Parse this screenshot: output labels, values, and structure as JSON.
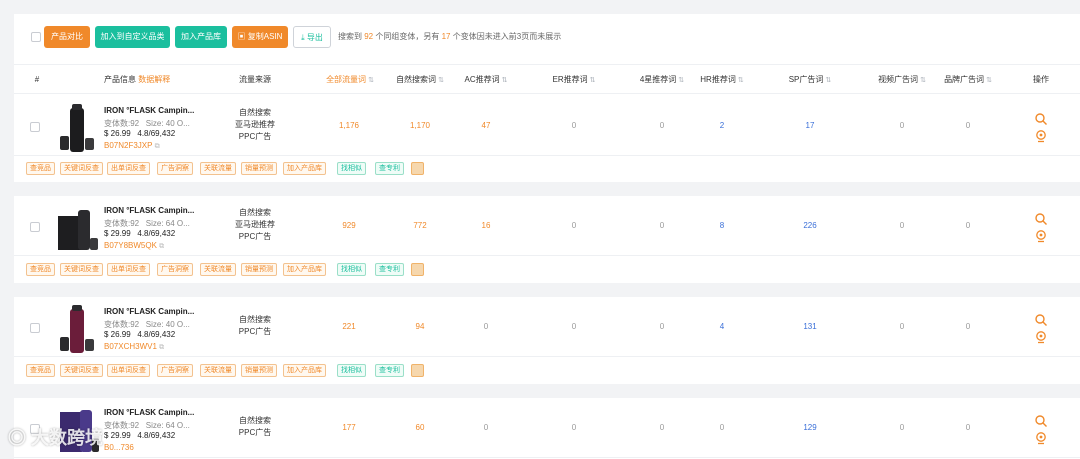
{
  "toolbar": {
    "compare_label": "产品对比",
    "add_custom_label": "加入到自定义品类",
    "add_library_label": "加入产品库",
    "copy_asin_label": "复制ASIN",
    "export_label": "导出",
    "info_prefix": "搜索到",
    "info_count": "92",
    "info_mid": "个同组变体，另有",
    "info_other": "17",
    "info_suffix": "个变体因未进入前3页而未展示"
  },
  "columns": {
    "index": "#",
    "product": "产品信息",
    "data_explain": "数据解释",
    "source": "流量来源",
    "all_keywords": "全部流量词",
    "organic": "自然搜索词",
    "ac": "AC推荐词",
    "er": "ER推荐词",
    "star4": "4星推荐词",
    "hr": "HR推荐词",
    "sp": "SP广告词",
    "video": "视频广告词",
    "brand": "品牌广告词",
    "action": "操作"
  },
  "rows": [
    {
      "name": "IRON °FLASK Campin...",
      "variants": "变体数:92",
      "size": "Size: 40 O...",
      "price": "$ 26.99",
      "rating": "4.8/69,432",
      "asin": "B07N2F3JXP",
      "sources": [
        "自然搜索",
        "亚马逊推荐",
        "PPC广告"
      ],
      "all": "1,176",
      "organic": "1,170",
      "ac": "47",
      "er": "0",
      "star4": "0",
      "hr": "2",
      "sp": "17",
      "video": "0",
      "brand": "0"
    },
    {
      "name": "IRON °FLASK Campin...",
      "variants": "变体数:92",
      "size": "Size: 64 O...",
      "price": "$ 29.99",
      "rating": "4.8/69,432",
      "asin": "B07Y8BW5QK",
      "sources": [
        "自然搜索",
        "亚马逊推荐",
        "PPC广告"
      ],
      "all": "929",
      "organic": "772",
      "ac": "16",
      "er": "0",
      "star4": "0",
      "hr": "8",
      "sp": "226",
      "video": "0",
      "brand": "0"
    },
    {
      "name": "IRON °FLASK Campin...",
      "variants": "变体数:92",
      "size": "Size: 40 O...",
      "price": "$ 26.99",
      "rating": "4.8/69,432",
      "asin": "B07XCH3WV1",
      "sources": [
        "自然搜索",
        "PPC广告"
      ],
      "all": "221",
      "organic": "94",
      "ac": "0",
      "er": "0",
      "star4": "0",
      "hr": "4",
      "sp": "131",
      "video": "0",
      "brand": "0"
    },
    {
      "name": "IRON °FLASK Campin...",
      "variants": "变体数:92",
      "size": "Size: 64 O...",
      "price": "$ 29.99",
      "rating": "4.8/69,432",
      "asin": "B0...736",
      "sources": [
        "自然搜索",
        "PPC广告"
      ],
      "all": "177",
      "organic": "60",
      "ac": "0",
      "er": "0",
      "star4": "0",
      "hr": "0",
      "sp": "129",
      "video": "0",
      "brand": "0"
    }
  ],
  "tags": [
    "查竞品",
    "关键词反查",
    "出单词反查",
    "广告洞察",
    "关联流量",
    "销量预测",
    "加入产品库",
    "找相似",
    "查专利"
  ],
  "watermark": "大数跨境",
  "colors": {
    "accent": "#f0892a",
    "teal": "#1bbf9e",
    "blue": "#3a6fd8"
  },
  "icons": {
    "search": "search-icon",
    "locate": "locate-icon",
    "calc": "calculator-icon",
    "copy": "copy-icon",
    "download": "download-icon"
  }
}
